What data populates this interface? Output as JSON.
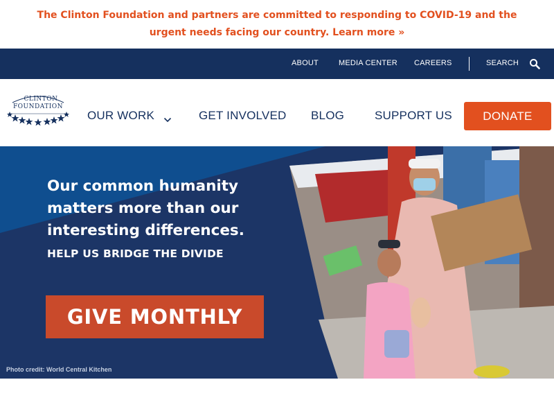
{
  "alert": {
    "text": "The Clinton Foundation and partners are committed to responding to COVID-19 and the urgent needs facing our country.",
    "link": "Learn more »"
  },
  "utility_nav": {
    "items": [
      "ABOUT",
      "MEDIA CENTER",
      "CAREERS"
    ],
    "search_label": "SEARCH"
  },
  "logo": {
    "line1": "CLINTON",
    "line2": "FOUNDATION"
  },
  "main_nav": {
    "items": [
      "OUR WORK",
      "GET INVOLVED",
      "BLOG",
      "SUPPORT US"
    ],
    "donate_label": "DONATE"
  },
  "hero": {
    "heading": "Our common humanity matters more than our interesting differences.",
    "subheading": "HELP US BRIDGE THE DIVIDE",
    "cta_label": "GIVE MONTHLY",
    "photo_credit": "Photo credit: World Central Kitchen"
  },
  "colors": {
    "navy": "#15305e",
    "accent_orange": "#e2501f",
    "cta_red": "#c94a2b"
  },
  "icons": {
    "search": "search-icon",
    "dropdown": "chevron-down-icon",
    "stars": "star-icon"
  }
}
